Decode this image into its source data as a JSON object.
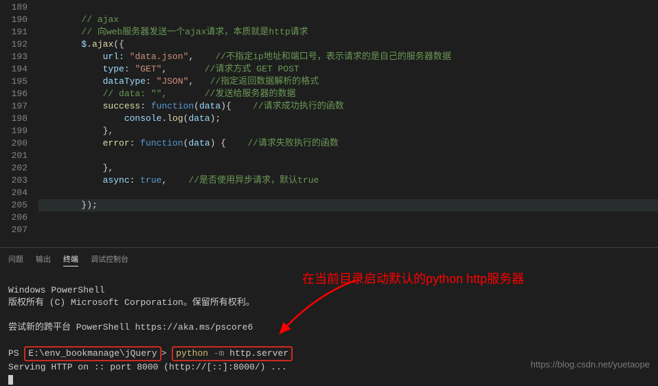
{
  "editor": {
    "lines": [
      {
        "num": 189,
        "tokens": [
          {
            "cls": "",
            "txt": "        "
          }
        ]
      },
      {
        "num": 190,
        "tokens": [
          {
            "cls": "",
            "txt": "        "
          },
          {
            "cls": "c-comment",
            "txt": "// ajax"
          }
        ]
      },
      {
        "num": 191,
        "tokens": [
          {
            "cls": "",
            "txt": "        "
          },
          {
            "cls": "c-comment",
            "txt": "// 向web服务器发送一个ajax请求，本质就是http请求"
          }
        ]
      },
      {
        "num": 192,
        "tokens": [
          {
            "cls": "",
            "txt": "        "
          },
          {
            "cls": "c-var",
            "txt": "$"
          },
          {
            "cls": "c-punct",
            "txt": "."
          },
          {
            "cls": "c-func",
            "txt": "ajax"
          },
          {
            "cls": "c-punct",
            "txt": "({"
          }
        ]
      },
      {
        "num": 193,
        "tokens": [
          {
            "cls": "",
            "txt": "            "
          },
          {
            "cls": "c-var",
            "txt": "url"
          },
          {
            "cls": "c-punct",
            "txt": ": "
          },
          {
            "cls": "c-str",
            "txt": "\"data.json\""
          },
          {
            "cls": "c-punct",
            "txt": ",    "
          },
          {
            "cls": "c-comment",
            "txt": "//不指定ip地址和端口号，表示请求的是自己的服务器数据"
          }
        ]
      },
      {
        "num": 194,
        "tokens": [
          {
            "cls": "",
            "txt": "            "
          },
          {
            "cls": "c-var",
            "txt": "type"
          },
          {
            "cls": "c-punct",
            "txt": ": "
          },
          {
            "cls": "c-str",
            "txt": "\"GET\""
          },
          {
            "cls": "c-punct",
            "txt": ",       "
          },
          {
            "cls": "c-comment",
            "txt": "//请求方式 GET POST"
          }
        ]
      },
      {
        "num": 195,
        "tokens": [
          {
            "cls": "",
            "txt": "            "
          },
          {
            "cls": "c-var",
            "txt": "dataType"
          },
          {
            "cls": "c-punct",
            "txt": ": "
          },
          {
            "cls": "c-str",
            "txt": "\"JSON\""
          },
          {
            "cls": "c-punct",
            "txt": ",   "
          },
          {
            "cls": "c-comment",
            "txt": "//指定返回数据解析的格式"
          }
        ]
      },
      {
        "num": 196,
        "tokens": [
          {
            "cls": "",
            "txt": "            "
          },
          {
            "cls": "c-comment",
            "txt": "// data: \"\",       //发送给服务器的数据"
          }
        ]
      },
      {
        "num": 197,
        "tokens": [
          {
            "cls": "",
            "txt": "            "
          },
          {
            "cls": "c-func",
            "txt": "success"
          },
          {
            "cls": "c-punct",
            "txt": ": "
          },
          {
            "cls": "c-key",
            "txt": "function"
          },
          {
            "cls": "c-punct",
            "txt": "("
          },
          {
            "cls": "c-var",
            "txt": "data"
          },
          {
            "cls": "c-punct",
            "txt": "){    "
          },
          {
            "cls": "c-comment",
            "txt": "//请求成功执行的函数"
          }
        ]
      },
      {
        "num": 198,
        "tokens": [
          {
            "cls": "",
            "txt": "                "
          },
          {
            "cls": "c-var",
            "txt": "console"
          },
          {
            "cls": "c-punct",
            "txt": "."
          },
          {
            "cls": "c-func",
            "txt": "log"
          },
          {
            "cls": "c-punct",
            "txt": "("
          },
          {
            "cls": "c-var",
            "txt": "data"
          },
          {
            "cls": "c-punct",
            "txt": ");"
          }
        ]
      },
      {
        "num": 199,
        "tokens": [
          {
            "cls": "",
            "txt": "            "
          },
          {
            "cls": "c-punct",
            "txt": "},"
          }
        ]
      },
      {
        "num": 200,
        "tokens": [
          {
            "cls": "",
            "txt": "            "
          },
          {
            "cls": "c-func",
            "txt": "error"
          },
          {
            "cls": "c-punct",
            "txt": ": "
          },
          {
            "cls": "c-key",
            "txt": "function"
          },
          {
            "cls": "c-punct",
            "txt": "("
          },
          {
            "cls": "c-var",
            "txt": "data"
          },
          {
            "cls": "c-punct",
            "txt": ") {    "
          },
          {
            "cls": "c-comment",
            "txt": "//请求失败执行的函数"
          }
        ]
      },
      {
        "num": 201,
        "tokens": [
          {
            "cls": "",
            "txt": "            "
          }
        ]
      },
      {
        "num": 202,
        "tokens": [
          {
            "cls": "",
            "txt": "            "
          },
          {
            "cls": "c-punct",
            "txt": "},"
          }
        ]
      },
      {
        "num": 203,
        "tokens": [
          {
            "cls": "",
            "txt": "            "
          },
          {
            "cls": "c-var",
            "txt": "async"
          },
          {
            "cls": "c-punct",
            "txt": ": "
          },
          {
            "cls": "c-const",
            "txt": "true"
          },
          {
            "cls": "c-punct",
            "txt": ",    "
          },
          {
            "cls": "c-comment",
            "txt": "//是否使用异步请求，默认true"
          }
        ]
      },
      {
        "num": 204,
        "tokens": [
          {
            "cls": "",
            "txt": "            "
          }
        ]
      },
      {
        "num": 205,
        "tokens": [
          {
            "cls": "",
            "txt": "        "
          },
          {
            "cls": "c-punct",
            "txt": "});"
          }
        ],
        "hl": true
      },
      {
        "num": 206,
        "tokens": [
          {
            "cls": "",
            "txt": "        "
          }
        ]
      },
      {
        "num": 207,
        "tokens": [
          {
            "cls": "",
            "txt": "        "
          }
        ]
      }
    ]
  },
  "panel": {
    "tabs": {
      "problems": "问题",
      "output": "输出",
      "terminal": "终端",
      "debug": "调试控制台"
    },
    "active_tab": "terminal"
  },
  "terminal": {
    "line1": "Windows PowerShell",
    "line2": "版权所有 (C) Microsoft Corporation。保留所有权利。",
    "line3": "尝试新的跨平台 PowerShell https://aka.ms/pscore6",
    "prompt_ps": "PS ",
    "prompt_path": "E:\\env_bookmanage\\jQuery",
    "prompt_gt": "> ",
    "cmd_py": "python ",
    "cmd_flag": "-m ",
    "cmd_mod": "http.server",
    "serving": "Serving HTTP on :: port 8000 (http://[::]:8000/) ..."
  },
  "annotation": "在当前目录启动默认的python http服务器",
  "watermark": "https://blog.csdn.net/yuetaope"
}
